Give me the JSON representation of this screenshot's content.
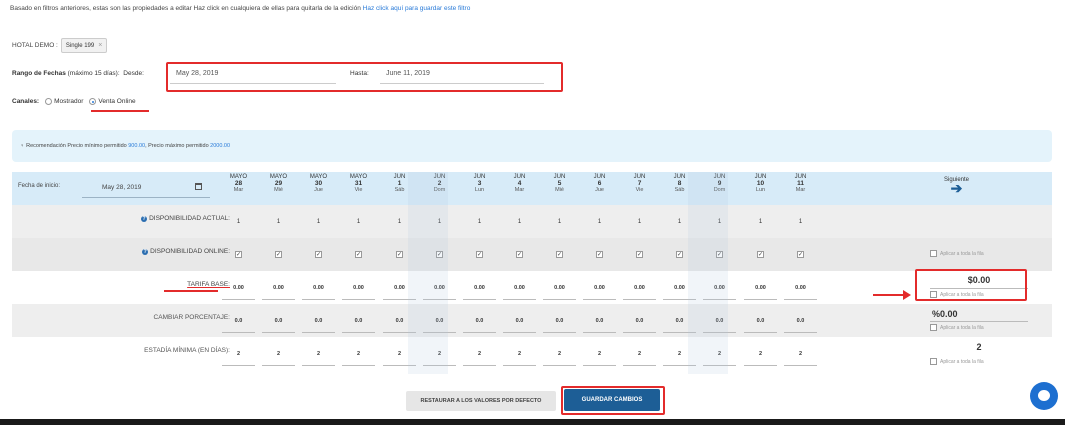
{
  "intro": {
    "text": "Basado en filtros anteriores, estas son las propiedades a editar Haz click en cualquiera de ellas para quitarla de la edición",
    "link": "Haz click aquí para guardar este filtro"
  },
  "hotel": {
    "label": "HOTAL DEMO :",
    "chip": "Single 199",
    "chip_close": "×"
  },
  "date_range": {
    "label_bold": "Rango de Fechas",
    "label_rest": "(máximo 15 días):",
    "desde_label": "Desde:",
    "desde_value": "May 28, 2019",
    "hasta_label": "Hasta:",
    "hasta_value": "June 11, 2019"
  },
  "channels": {
    "label": "Canales:",
    "options": [
      {
        "label": "Mostrador",
        "selected": false
      },
      {
        "label": "Venta Online",
        "selected": true
      }
    ]
  },
  "recommendation": {
    "prefix": "Recomendación Precio mínimo permitido",
    "min": "900.00",
    "middle": ", Precio máximo permitido",
    "max": "2000.00"
  },
  "header": {
    "start_label": "Fecha de inicio:",
    "start_value": "May 28, 2019",
    "next_label": "Siguiente",
    "next_icon": "arrow-right-icon",
    "days": [
      {
        "month": "MAYO",
        "day": "28",
        "weekday": "Mar"
      },
      {
        "month": "MAYO",
        "day": "29",
        "weekday": "Mié"
      },
      {
        "month": "MAYO",
        "day": "30",
        "weekday": "Jue"
      },
      {
        "month": "MAYO",
        "day": "31",
        "weekday": "Vie"
      },
      {
        "month": "JUN",
        "day": "1",
        "weekday": "Sáb"
      },
      {
        "month": "JUN",
        "day": "2",
        "weekday": "Dom"
      },
      {
        "month": "JUN",
        "day": "3",
        "weekday": "Lun"
      },
      {
        "month": "JUN",
        "day": "4",
        "weekday": "Mar"
      },
      {
        "month": "JUN",
        "day": "5",
        "weekday": "Mié"
      },
      {
        "month": "JUN",
        "day": "6",
        "weekday": "Jue"
      },
      {
        "month": "JUN",
        "day": "7",
        "weekday": "Vie"
      },
      {
        "month": "JUN",
        "day": "8",
        "weekday": "Sáb"
      },
      {
        "month": "JUN",
        "day": "9",
        "weekday": "Dom"
      },
      {
        "month": "JUN",
        "day": "10",
        "weekday": "Lun"
      },
      {
        "month": "JUN",
        "day": "11",
        "weekday": "Mar"
      }
    ]
  },
  "rows": {
    "disp_actual": {
      "label": "DISPONIBILIDAD ACTUAL:",
      "values": [
        "1",
        "1",
        "1",
        "1",
        "1",
        "1",
        "1",
        "1",
        "1",
        "1",
        "1",
        "1",
        "1",
        "1",
        "1"
      ]
    },
    "disp_online": {
      "label": "DISPONIBILIDAD ONLINE:",
      "apply": "Aplicar a toda la fila"
    },
    "tarifa": {
      "label": "TARIFA BASE:",
      "values": [
        "0.00",
        "0.00",
        "0.00",
        "0.00",
        "0.00",
        "0.00",
        "0.00",
        "0.00",
        "0.00",
        "0.00",
        "0.00",
        "0.00",
        "0.00",
        "0.00",
        "0.00"
      ],
      "side_value": "$0.00",
      "apply": "Aplicar a toda la fila"
    },
    "porcentaje": {
      "label": "CAMBIAR PORCENTAJE:",
      "values": [
        "0.0",
        "0.0",
        "0.0",
        "0.0",
        "0.0",
        "0.0",
        "0.0",
        "0.0",
        "0.0",
        "0.0",
        "0.0",
        "0.0",
        "0.0",
        "0.0",
        "0.0"
      ],
      "side_value": "%0.00",
      "apply": "Aplicar a toda la fila"
    },
    "estadia": {
      "label": "ESTADÍA MÍNIMA (EN DÍAS):",
      "values": [
        "2",
        "2",
        "2",
        "2",
        "2",
        "2",
        "2",
        "2",
        "2",
        "2",
        "2",
        "2",
        "2",
        "2",
        "2"
      ],
      "side_value": "2",
      "apply": "Aplicar a toda la fila"
    }
  },
  "buttons": {
    "restore": "RESTAURAR A LOS VALORES POR DEFECTO",
    "save": "GUARDAR CAMBIOS"
  },
  "colors": {
    "accent": "#1d5e96",
    "highlight": "#e32b2b",
    "info_bg": "#e4f3fb"
  },
  "chat_icon": "chat-bubble-icon"
}
